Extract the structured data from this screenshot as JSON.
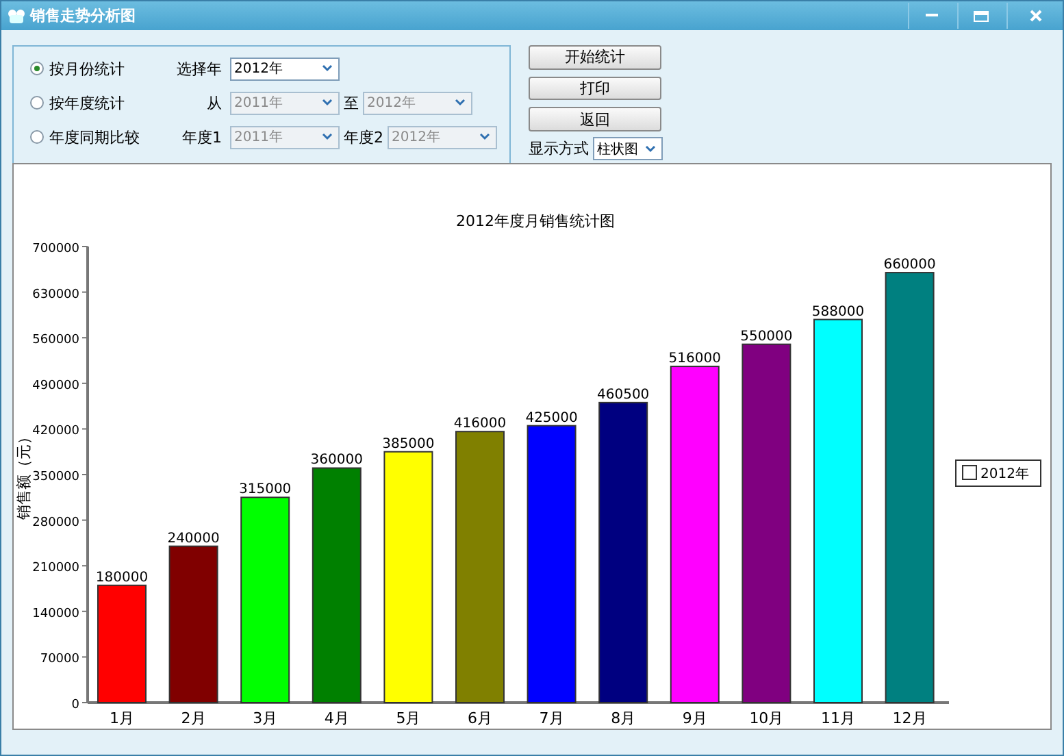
{
  "window": {
    "title": "销售走势分析图"
  },
  "filter": {
    "rows": [
      {
        "label": "按月份统计",
        "selected": true,
        "fields": [
          {
            "label": "选择年",
            "value": "2012年",
            "disabled": false
          }
        ]
      },
      {
        "label": "按年度统计",
        "selected": false,
        "fields": [
          {
            "label": "从",
            "value": "2011年",
            "disabled": true
          },
          {
            "label": "至",
            "value": "2012年",
            "disabled": true
          }
        ]
      },
      {
        "label": "年度同期比较",
        "selected": false,
        "fields": [
          {
            "label": "年度1",
            "value": "2011年",
            "disabled": true
          },
          {
            "label": "年度2",
            "value": "2012年",
            "disabled": true
          }
        ]
      }
    ]
  },
  "buttons": [
    "开始统计",
    "打印",
    "返回"
  ],
  "display_mode": {
    "label": "显示方式",
    "value": "柱状图"
  },
  "chart": {
    "bars": [
      {
        "color": "#ff0000"
      },
      {
        "color": "#800000"
      },
      {
        "color": "#00ff00"
      },
      {
        "color": "#008000"
      },
      {
        "color": "#ffff00"
      },
      {
        "color": "#808000"
      },
      {
        "color": "#0000ff"
      },
      {
        "color": "#000080"
      },
      {
        "color": "#ff00ff"
      },
      {
        "color": "#800080"
      },
      {
        "color": "#00ffff"
      },
      {
        "color": "#008080"
      }
    ],
    "chart_data": {
      "type": "bar",
      "title": "2012年度月销售统计图",
      "ylabel": "销售额（元）",
      "categories": [
        "1月",
        "2月",
        "3月",
        "4月",
        "5月",
        "6月",
        "7月",
        "8月",
        "9月",
        "10月",
        "11月",
        "12月"
      ],
      "series": [
        {
          "name": "2012年",
          "values": [
            180000,
            240000,
            315000,
            360000,
            385000,
            416000,
            425000,
            460500,
            516000,
            550000,
            588000,
            660000
          ]
        }
      ],
      "ylim": [
        0,
        700000
      ],
      "yticks": [
        0,
        70000,
        140000,
        210000,
        280000,
        350000,
        420000,
        490000,
        560000,
        630000,
        700000
      ],
      "data_labels": true
    }
  }
}
